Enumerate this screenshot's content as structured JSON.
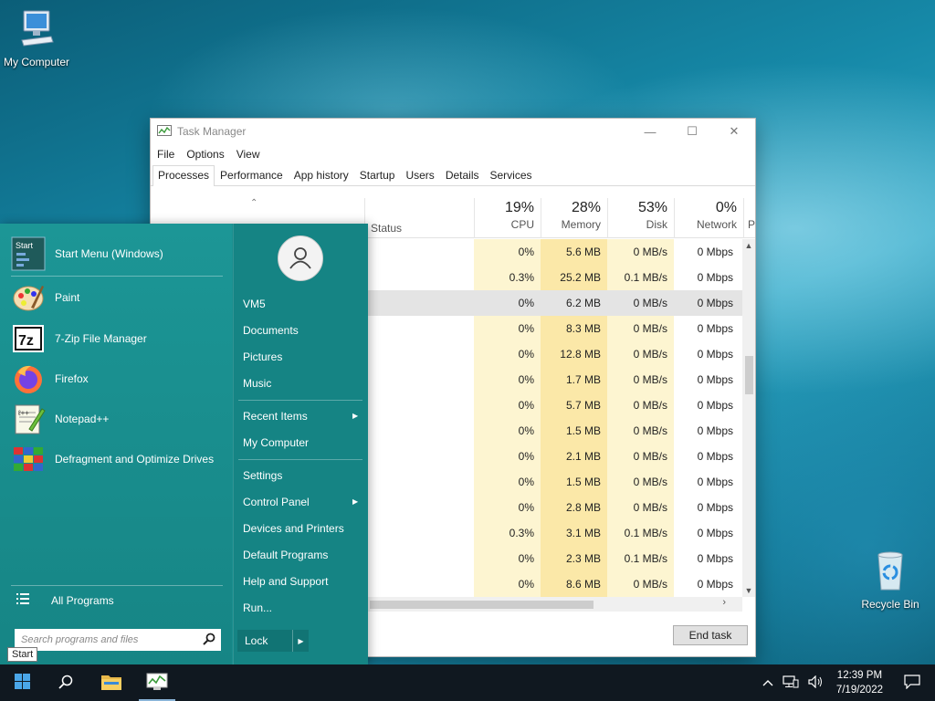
{
  "desktop": {
    "my_computer_label": "My Computer",
    "recycle_bin_label": "Recycle Bin"
  },
  "task_manager": {
    "title": "Task Manager",
    "menu": [
      "File",
      "Options",
      "View"
    ],
    "tabs": [
      "Processes",
      "Performance",
      "App history",
      "Startup",
      "Users",
      "Details",
      "Services"
    ],
    "active_tab": "Processes",
    "columns": {
      "status": "Status",
      "cpu": {
        "pct": "19%",
        "label": "CPU"
      },
      "memory": {
        "pct": "28%",
        "label": "Memory"
      },
      "disk": {
        "pct": "53%",
        "label": "Disk"
      },
      "network": {
        "pct": "0%",
        "label": "Network"
      },
      "cut": "P"
    },
    "rows": [
      {
        "cpu": "0%",
        "mem": "5.6 MB",
        "disk": "0 MB/s",
        "net": "0 Mbps"
      },
      {
        "cpu": "0.3%",
        "mem": "25.2 MB",
        "disk": "0.1 MB/s",
        "net": "0 Mbps"
      },
      {
        "cpu": "0%",
        "mem": "6.2 MB",
        "disk": "0 MB/s",
        "net": "0 Mbps"
      },
      {
        "cpu": "0%",
        "mem": "8.3 MB",
        "disk": "0 MB/s",
        "net": "0 Mbps"
      },
      {
        "cpu": "0%",
        "mem": "12.8 MB",
        "disk": "0 MB/s",
        "net": "0 Mbps"
      },
      {
        "cpu": "0%",
        "mem": "1.7 MB",
        "disk": "0 MB/s",
        "net": "0 Mbps"
      },
      {
        "cpu": "0%",
        "mem": "5.7 MB",
        "disk": "0 MB/s",
        "net": "0 Mbps"
      },
      {
        "cpu": "0%",
        "mem": "1.5 MB",
        "disk": "0 MB/s",
        "net": "0 Mbps"
      },
      {
        "cpu": "0%",
        "mem": "2.1 MB",
        "disk": "0 MB/s",
        "net": "0 Mbps"
      },
      {
        "cpu": "0%",
        "mem": "1.5 MB",
        "disk": "0 MB/s",
        "net": "0 Mbps"
      },
      {
        "cpu": "0%",
        "mem": "2.8 MB",
        "disk": "0 MB/s",
        "net": "0 Mbps"
      },
      {
        "cpu": "0.3%",
        "mem": "3.1 MB",
        "disk": "0.1 MB/s",
        "net": "0 Mbps"
      },
      {
        "cpu": "0%",
        "mem": "2.3 MB",
        "disk": "0.1 MB/s",
        "net": "0 Mbps"
      },
      {
        "cpu": "0%",
        "mem": "8.6 MB",
        "disk": "0 MB/s",
        "net": "0 Mbps"
      }
    ],
    "end_task_label": "End task"
  },
  "start_menu": {
    "pinned": [
      {
        "label": "Start Menu (Windows)",
        "icon": "start-menu-app-icon"
      },
      {
        "label": "Paint",
        "icon": "paint-icon"
      },
      {
        "label": "7-Zip File Manager",
        "icon": "7zip-icon"
      },
      {
        "label": "Firefox",
        "icon": "firefox-icon"
      },
      {
        "label": "Notepad++",
        "icon": "notepadpp-icon"
      },
      {
        "label": "Defragment and Optimize Drives",
        "icon": "defrag-icon"
      }
    ],
    "start_icon_text": "Start",
    "all_programs": "All Programs",
    "search_placeholder": "Search programs and files",
    "right": {
      "user": "VM5",
      "documents": "Documents",
      "pictures": "Pictures",
      "music": "Music",
      "recent_items": "Recent Items",
      "my_computer": "My Computer",
      "settings": "Settings",
      "control_panel": "Control Panel",
      "devices_printers": "Devices and Printers",
      "default_programs": "Default Programs",
      "help_support": "Help and Support",
      "run": "Run..."
    },
    "lock_label": "Lock",
    "tooltip": "Start"
  },
  "taskbar": {
    "time": "12:39 PM",
    "date": "7/19/2022"
  },
  "colors": {
    "start_menu_bg": "#1a8f8f",
    "cpu_highlight": "#fdf5d1",
    "memory_highlight": "#fbe8a8",
    "taskbar_bg": "#101820"
  }
}
